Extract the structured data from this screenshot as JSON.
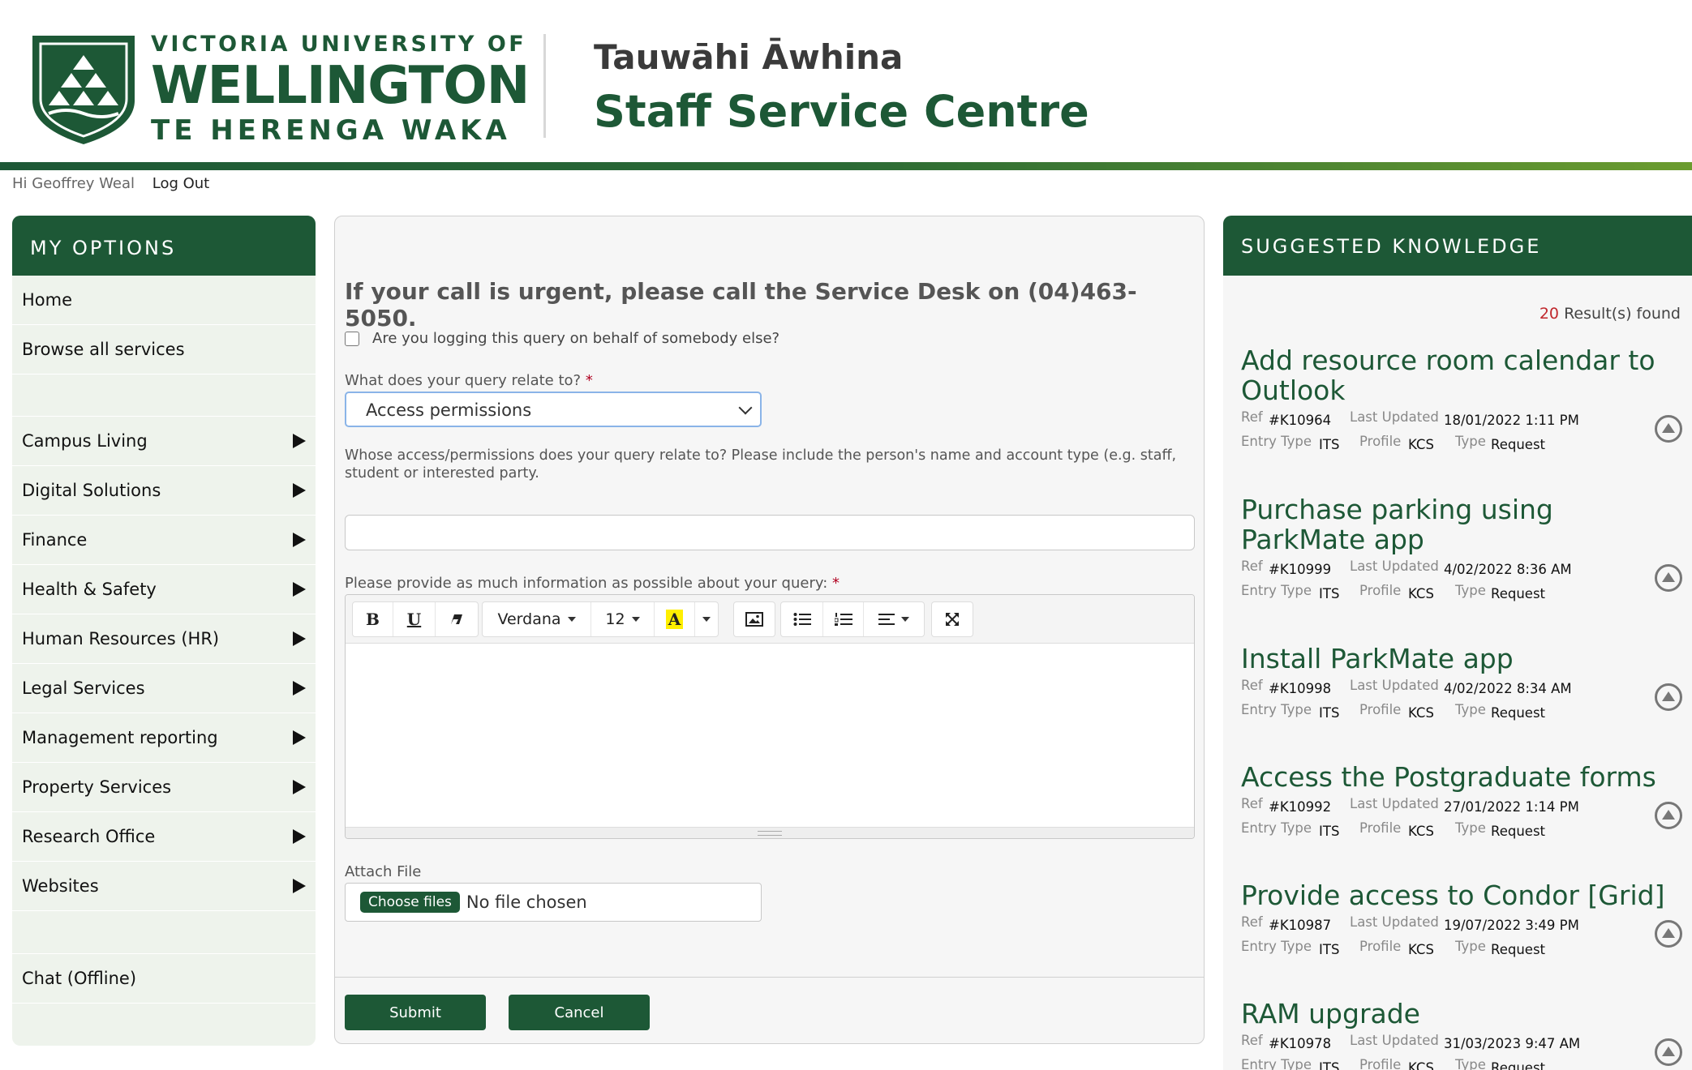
{
  "header": {
    "logo_top": "VICTORIA UNIVERSITY OF",
    "logo_mid": "WELLINGTON",
    "logo_bot": "TE HERENGA WAKA",
    "brand_line1": "Tauwāhi Āwhina",
    "brand_line2": "Staff Service Centre"
  },
  "userbar": {
    "greeting": "Hi Geoffrey Weal",
    "logout": "Log Out"
  },
  "sidebar": {
    "title": "MY OPTIONS",
    "top_items": [
      "Home",
      "Browse all services"
    ],
    "categories": [
      "Campus Living",
      "Digital Solutions",
      "Finance",
      "Health & Safety",
      "Human Resources (HR)",
      "Legal Services",
      "Management reporting",
      "Property Services",
      "Research Office",
      "Websites"
    ],
    "chat": "Chat (Offline)"
  },
  "form": {
    "urgent": "If your call is urgent, please call the Service Desk on (04)463-5050.",
    "behalf_label": "Are you logging this query on behalf of somebody else?",
    "relate_label": "What does your query relate to?",
    "required_mark": "*",
    "relate_value": "Access permissions",
    "whose_help": "Whose access/permissions does your query relate to? Please include the person's name and account type (e.g. staff, student or interested party.",
    "whose_value": "",
    "info_label": "Please provide as much information as possible about your query:",
    "editor": {
      "font": "Verdana",
      "size": "12",
      "bold": "B",
      "underline": "U",
      "color_glyph": "A"
    },
    "attach_label": "Attach File",
    "choose_files": "Choose files",
    "no_file": "No file chosen",
    "submit": "Submit",
    "cancel": "Cancel"
  },
  "knowledge": {
    "title": "SUGGESTED KNOWLEDGE",
    "count": "20",
    "count_suffix": "Result(s) found",
    "labels": {
      "ref": "Ref",
      "updated": "Last Updated",
      "entry": "Entry Type",
      "profile": "Profile",
      "type": "Type"
    },
    "items": [
      {
        "title": "Add resource room calendar to Outlook",
        "ref": "#K10964",
        "updated": "18/01/2022 1:11 PM",
        "entry": "ITS",
        "profile": "KCS",
        "type": "Request"
      },
      {
        "title": "Purchase parking using ParkMate app",
        "ref": "#K10999",
        "updated": "4/02/2022 8:36 AM",
        "entry": "ITS",
        "profile": "KCS",
        "type": "Request"
      },
      {
        "title": "Install ParkMate app",
        "ref": "#K10998",
        "updated": "4/02/2022 8:34 AM",
        "entry": "ITS",
        "profile": "KCS",
        "type": "Request"
      },
      {
        "title": "Access the Postgraduate forms",
        "ref": "#K10992",
        "updated": "27/01/2022 1:14 PM",
        "entry": "ITS",
        "profile": "KCS",
        "type": "Request"
      },
      {
        "title": "Provide access to Condor [Grid]",
        "ref": "#K10987",
        "updated": "19/07/2022 3:49 PM",
        "entry": "ITS",
        "profile": "KCS",
        "type": "Request"
      },
      {
        "title": "RAM upgrade",
        "ref": "#K10978",
        "updated": "31/03/2023 9:47 AM",
        "entry": "ITS",
        "profile": "KCS",
        "type": "Request"
      }
    ]
  },
  "colors": {
    "brand_green": "#1d5836",
    "required_red": "#b00020",
    "count_red": "#c0282d"
  }
}
